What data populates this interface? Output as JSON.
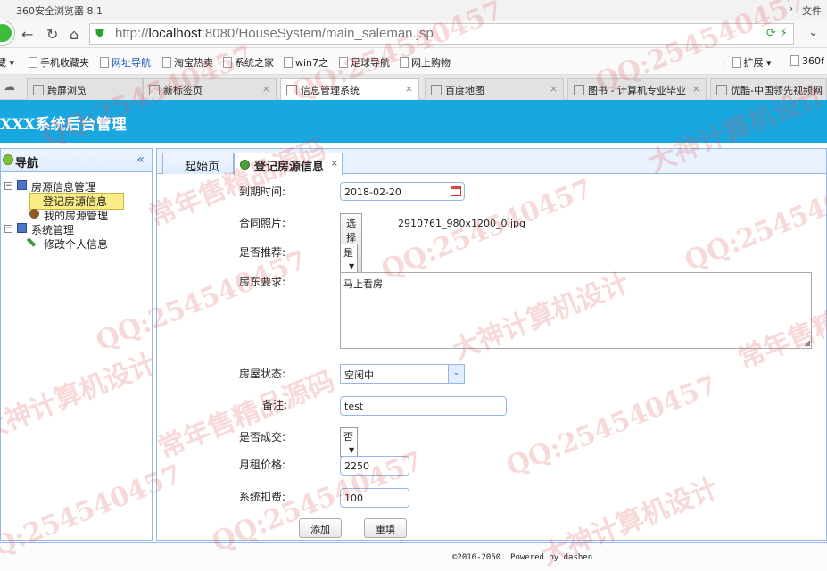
{
  "browser": {
    "window_title": "360安全浏览器 8.1",
    "window_menu": "文件",
    "url_prefix": "http://",
    "url_host": "localhost",
    "url_path": ":8080/HouseSystem/main_saleman.jsp",
    "bookmarks": [
      "藏",
      "手机收藏夹",
      "网址导航",
      "淘宝热卖",
      "系统之家",
      "win7之",
      "足球导航",
      "网上购物",
      "扩展",
      "360f"
    ],
    "tabs": [
      "跨屏浏览",
      "新标签页",
      "信息管理系统",
      "百度地图",
      "图书 - 计算机专业毕业",
      "优酷-中国领先视频网"
    ]
  },
  "app": {
    "title": "XXX系统后台管理"
  },
  "sidebar": {
    "header": "导航",
    "collapse_glyph": "«",
    "tree": {
      "group1": "房源信息管理",
      "item1": "登记房源信息",
      "item2": "我的房源管理",
      "group2": "系统管理",
      "item3": "修改个人信息"
    }
  },
  "main": {
    "tabs": [
      "起始页",
      "登记房源信息"
    ],
    "form": {
      "expire_label": "到期时间:",
      "expire_value": "2018-02-20",
      "photo_label": "合同照片:",
      "photo_button": "选择文件",
      "photo_file": "2910761_980x1200_0.jpg",
      "recommend_label": "是否推荐:",
      "recommend_value": "是",
      "requirement_label": "房东要求:",
      "requirement_value": "马上看房",
      "status_label": "房屋状态:",
      "status_value": "空闲中",
      "note_label": "备注:",
      "note_value": "test",
      "deal_label": "是否成交:",
      "deal_value": "否",
      "rent_label": "月租价格:",
      "rent_value": "2250",
      "fee_label": "系统扣费:",
      "fee_value": "100",
      "add_button": "添加",
      "reset_button": "重填"
    }
  },
  "footer": {
    "text": "©2016-2050. Powered by dashen"
  },
  "watermarks": [
    "QQ:254540457",
    "常年售精品源码",
    "大神计算机设计"
  ],
  "colors": {
    "header_blue": "#19a7e0",
    "panel_border": "#95b8e7",
    "watermark": "#e15050"
  }
}
